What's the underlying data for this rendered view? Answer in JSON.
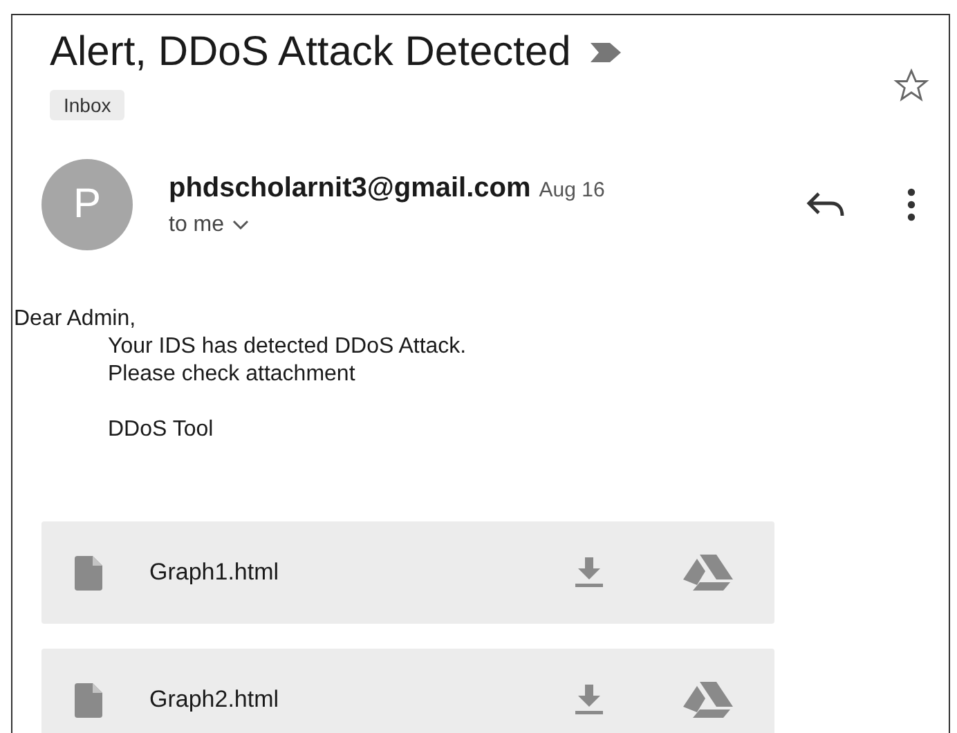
{
  "subject": "Alert, DDoS Attack Detected",
  "label": "Inbox",
  "sender": {
    "initial": "P",
    "address": "phdscholarnit3@gmail.com",
    "date": "Aug 16",
    "recipient": "to me"
  },
  "body": {
    "greeting": "Dear Admin,",
    "lines": [
      "Your IDS has detected DDoS Attack.",
      "Please check attachment"
    ],
    "signature": "DDoS Tool"
  },
  "attachments": [
    {
      "name": "Graph1.html"
    },
    {
      "name": "Graph2.html"
    }
  ]
}
